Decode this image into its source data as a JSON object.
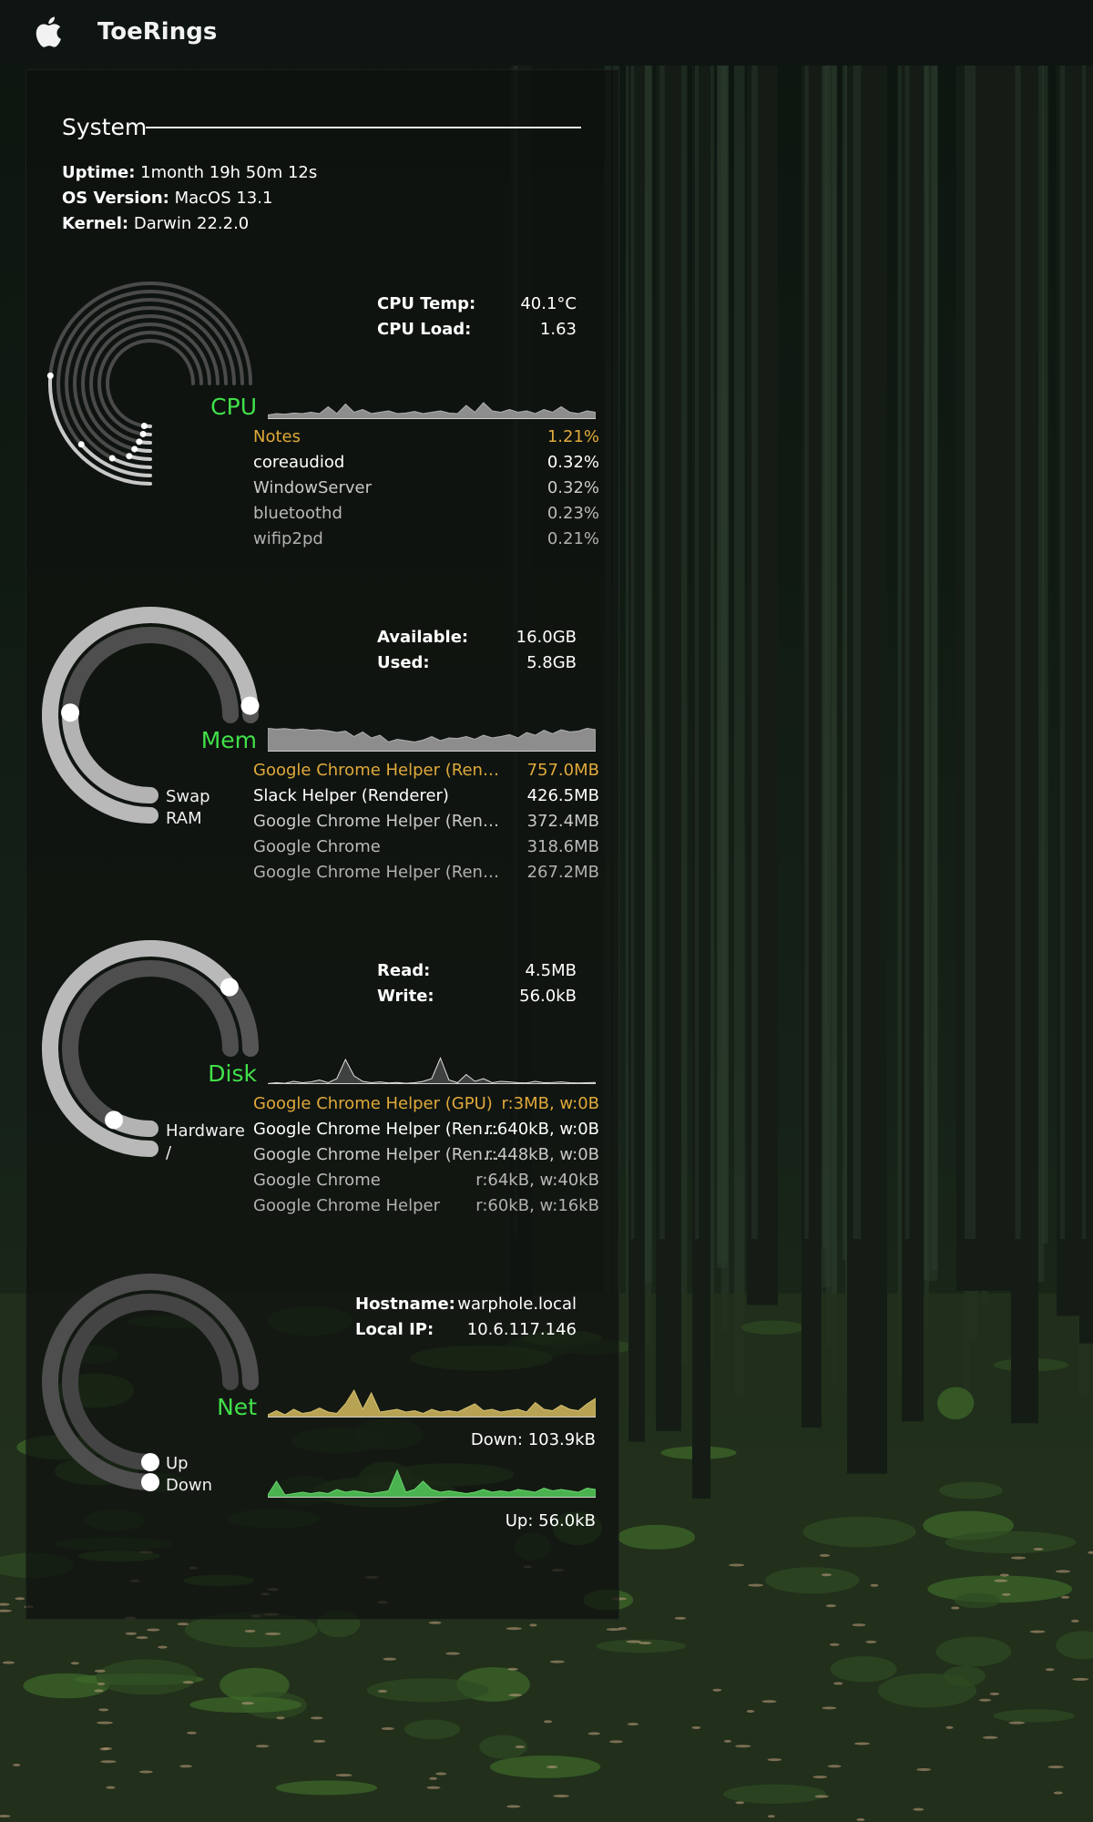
{
  "app": {
    "title": "ToeRings"
  },
  "system": {
    "heading": "System",
    "uptime_label": "Uptime:",
    "uptime": "1month 19h 50m 12s",
    "os_label": "OS Version:",
    "os": "MacOS 13.1",
    "kernel_label": "Kernel:",
    "kernel": "Darwin 22.2.0"
  },
  "cpu": {
    "title": "CPU",
    "temp_label": "CPU Temp:",
    "temp": "40.1°C",
    "load_label": "CPU Load:",
    "load": "1.63",
    "core_usage": [
      0.35,
      0.18,
      0.1,
      0.06,
      0.05,
      0.04,
      0.03,
      0.03
    ],
    "processes": [
      {
        "name": "Notes",
        "value": "1.21%"
      },
      {
        "name": "coreaudiod",
        "value": "0.32%"
      },
      {
        "name": "WindowServer",
        "value": "0.32%"
      },
      {
        "name": "bluetoothd",
        "value": "0.23%"
      },
      {
        "name": "wifip2pd",
        "value": "0.21%"
      }
    ],
    "history": [
      0.15,
      0.2,
      0.18,
      0.22,
      0.2,
      0.25,
      0.2,
      0.45,
      0.2,
      0.55,
      0.25,
      0.35,
      0.2,
      0.25,
      0.3,
      0.2,
      0.22,
      0.28,
      0.2,
      0.25,
      0.3,
      0.22,
      0.2,
      0.5,
      0.25,
      0.6,
      0.3,
      0.25,
      0.35,
      0.25,
      0.3,
      0.2,
      0.35,
      0.25,
      0.45,
      0.25,
      0.2,
      0.3,
      0.25
    ]
  },
  "mem": {
    "title": "Mem",
    "available_label": "Available:",
    "available": "16.0GB",
    "used_label": "Used:",
    "used": "5.8GB",
    "swap_label": "Swap",
    "ram_label": "RAM",
    "swap_fraction": 0.98,
    "ram_fraction": 0.34,
    "processes": [
      {
        "name": "Google Chrome Helper (Renderer)",
        "value": "757.0MB"
      },
      {
        "name": "Slack Helper (Renderer)",
        "value": "426.5MB"
      },
      {
        "name": "Google Chrome Helper (Renderer)",
        "value": "372.4MB"
      },
      {
        "name": "Google Chrome",
        "value": "318.6MB"
      },
      {
        "name": "Google Chrome Helper (Renderer)",
        "value": "267.2MB"
      }
    ],
    "history": [
      0.85,
      0.82,
      0.84,
      0.8,
      0.83,
      0.78,
      0.8,
      0.76,
      0.7,
      0.75,
      0.55,
      0.72,
      0.5,
      0.6,
      0.35,
      0.45,
      0.4,
      0.35,
      0.42,
      0.55,
      0.4,
      0.5,
      0.48,
      0.55,
      0.45,
      0.6,
      0.5,
      0.55,
      0.62,
      0.5,
      0.7,
      0.6,
      0.78,
      0.65,
      0.8,
      0.72,
      0.75,
      0.85,
      0.8
    ]
  },
  "disk": {
    "title": "Disk",
    "read_label": "Read:",
    "read": "4.5MB",
    "write_label": "Write:",
    "write": "56.0kB",
    "hardware_label": "Hardware",
    "root_label": "/",
    "hardware_fraction": 0.86,
    "root_fraction": 0.1,
    "processes": [
      {
        "name": "Google Chrome Helper (GPU)",
        "value": "r:3MB, w:0B"
      },
      {
        "name": "Google Chrome Helper (Renderer)",
        "value": "r:640kB, w:0B"
      },
      {
        "name": "Google Chrome Helper (Renderer)",
        "value": "r:448kB, w:0B"
      },
      {
        "name": "Google Chrome",
        "value": "r:64kB, w:40kB"
      },
      {
        "name": "Google Chrome Helper",
        "value": "r:60kB, w:16kB"
      }
    ],
    "history": [
      0.02,
      0.05,
      0.03,
      0.1,
      0.05,
      0.08,
      0.15,
      0.05,
      0.2,
      0.9,
      0.3,
      0.1,
      0.05,
      0.08,
      0.04,
      0.06,
      0.03,
      0.05,
      0.1,
      0.2,
      0.95,
      0.15,
      0.05,
      0.35,
      0.1,
      0.2,
      0.05,
      0.1,
      0.08,
      0.05,
      0.04,
      0.1,
      0.05,
      0.06,
      0.08,
      0.05,
      0.04,
      0.05,
      0.06
    ]
  },
  "net": {
    "title": "Net",
    "hostname_label": "Hostname:",
    "hostname": "warphole.local",
    "ip_label": "Local IP:",
    "ip": "10.6.117.146",
    "up_label": "Up",
    "down_label": "Down",
    "down_text": "Down: 103.9kB",
    "up_text": "Up: 56.0kB",
    "down_history": [
      0.1,
      0.25,
      0.1,
      0.3,
      0.15,
      0.2,
      0.35,
      0.2,
      0.15,
      0.5,
      1.0,
      0.3,
      0.9,
      0.2,
      0.25,
      0.3,
      0.2,
      0.25,
      0.15,
      0.3,
      0.2,
      0.25,
      0.2,
      0.35,
      0.5,
      0.25,
      0.3,
      0.2,
      0.25,
      0.3,
      0.2,
      0.55,
      0.3,
      0.25,
      0.45,
      0.3,
      0.25,
      0.5,
      0.7
    ],
    "up_history": [
      0.1,
      0.6,
      0.1,
      0.15,
      0.2,
      0.15,
      0.2,
      0.15,
      0.3,
      0.2,
      0.25,
      0.2,
      0.15,
      0.2,
      0.25,
      1.0,
      0.2,
      0.3,
      0.6,
      0.3,
      0.2,
      0.25,
      0.2,
      0.15,
      0.2,
      0.3,
      0.2,
      0.25,
      0.2,
      0.3,
      0.25,
      0.2,
      0.35,
      0.25,
      0.3,
      0.25,
      0.2,
      0.35,
      0.3
    ]
  },
  "colors": {
    "accent_green": "#41e04a",
    "highlight_orange": "#e0a93a",
    "net_down_fill": "#b8a254",
    "net_up_fill": "#4ab34f"
  }
}
